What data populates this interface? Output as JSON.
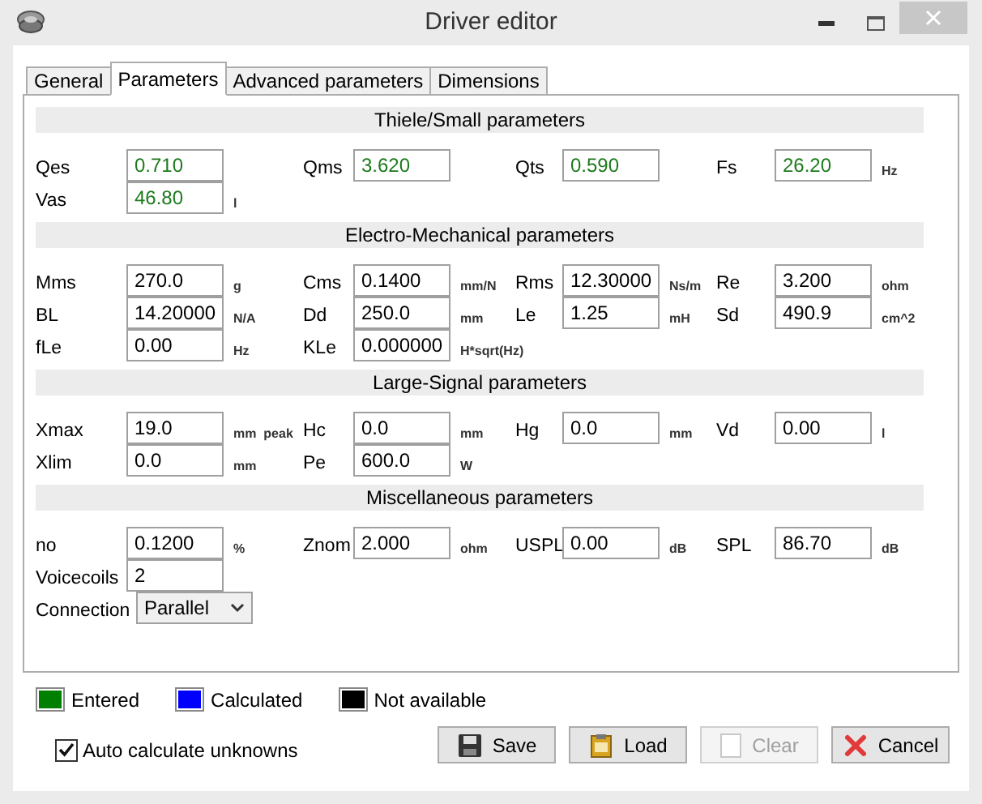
{
  "window": {
    "title": "Driver editor"
  },
  "tabs": [
    {
      "label": "General",
      "selected": false
    },
    {
      "label": "Parameters",
      "selected": true
    },
    {
      "label": "Advanced parameters",
      "selected": false
    },
    {
      "label": "Dimensions",
      "selected": false
    }
  ],
  "sections": [
    {
      "title": "Thiele/Small parameters",
      "rows": [
        [
          {
            "kind": "field",
            "label": "Qes",
            "value": "0.710",
            "entered": true
          },
          {
            "kind": "field",
            "label": "Qms",
            "value": "3.620",
            "entered": true
          },
          {
            "kind": "field",
            "label": "Qts",
            "value": "0.590",
            "entered": true
          },
          {
            "kind": "field",
            "label": "Fs",
            "value": "26.20",
            "unit": "Hz",
            "entered": true
          }
        ],
        [
          {
            "kind": "field",
            "label": "Vas",
            "value": "46.80",
            "unit": "l",
            "entered": true
          }
        ]
      ]
    },
    {
      "title": "Electro-Mechanical parameters",
      "rows": [
        [
          {
            "kind": "field",
            "label": "Mms",
            "value": "270.0",
            "unit": "g",
            "entered": false
          },
          {
            "kind": "field",
            "label": "Cms",
            "value": "0.1400",
            "unit": "mm/N",
            "entered": false
          },
          {
            "kind": "field",
            "label": "Rms",
            "value": "12.30000",
            "unit": "Ns/m",
            "entered": false
          },
          {
            "kind": "field",
            "label": "Re",
            "value": "3.200",
            "unit": "ohm",
            "entered": false
          }
        ],
        [
          {
            "kind": "field",
            "label": "BL",
            "value": "14.20000",
            "unit": "N/A",
            "entered": false
          },
          {
            "kind": "field",
            "label": "Dd",
            "value": "250.0",
            "unit": "mm",
            "entered": false
          },
          {
            "kind": "field",
            "label": "Le",
            "value": "1.25",
            "unit": "mH",
            "entered": false
          },
          {
            "kind": "field",
            "label": "Sd",
            "value": "490.9",
            "unit": "cm^2",
            "entered": false
          }
        ],
        [
          {
            "kind": "field",
            "label": "fLe",
            "value": "0.00",
            "unit": "Hz",
            "entered": false
          },
          {
            "kind": "field",
            "label": "KLe",
            "value": "0.000000",
            "unit": "H*sqrt(Hz)",
            "entered": false
          }
        ]
      ]
    },
    {
      "title": "Large-Signal parameters",
      "rows": [
        [
          {
            "kind": "field",
            "label": "Xmax",
            "value": "19.0",
            "unit": "mm  peak",
            "entered": false
          },
          {
            "kind": "field",
            "label": "Hc",
            "value": "0.0",
            "unit": "mm",
            "entered": false
          },
          {
            "kind": "field",
            "label": "Hg",
            "value": "0.0",
            "unit": "mm",
            "entered": false
          },
          {
            "kind": "field",
            "label": "Vd",
            "value": "0.00",
            "unit": "l",
            "entered": false
          }
        ],
        [
          {
            "kind": "field",
            "label": "Xlim",
            "value": "0.0",
            "unit": "mm",
            "entered": false
          },
          {
            "kind": "field",
            "label": "Pe",
            "value": "600.0",
            "unit": "W",
            "entered": false
          }
        ]
      ]
    },
    {
      "title": "Miscellaneous parameters",
      "rows": [
        [
          {
            "kind": "field",
            "label": "no",
            "value": "0.1200",
            "unit": "%",
            "entered": false
          },
          {
            "kind": "field",
            "label": "Znom",
            "value": "2.000",
            "unit": "ohm",
            "entered": false
          },
          {
            "kind": "field",
            "label": "USPL",
            "value": "0.00",
            "unit": "dB",
            "entered": false
          },
          {
            "kind": "field",
            "label": "SPL",
            "value": "86.70",
            "unit": "dB",
            "entered": false
          }
        ],
        [
          {
            "kind": "field",
            "label": "Voicecoils",
            "value": "2",
            "entered": false
          }
        ],
        [
          {
            "kind": "select",
            "label": "Connection",
            "value": "Parallel"
          }
        ]
      ]
    }
  ],
  "legend": [
    {
      "label": "Entered",
      "color": "#008000"
    },
    {
      "label": "Calculated",
      "color": "#0000ff"
    },
    {
      "label": "Not available",
      "color": "#000000"
    }
  ],
  "auto_calculate": {
    "label": "Auto calculate unknowns",
    "checked": true
  },
  "buttons": [
    {
      "kind": "save",
      "label": "Save",
      "disabled": false
    },
    {
      "kind": "load",
      "label": "Load",
      "disabled": false
    },
    {
      "kind": "clear",
      "label": "Clear",
      "disabled": true
    },
    {
      "kind": "cancel",
      "label": "Cancel",
      "disabled": false
    }
  ]
}
